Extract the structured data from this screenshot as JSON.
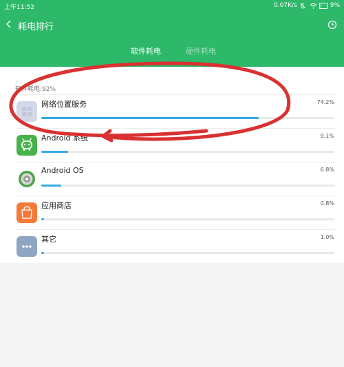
{
  "status_bar": {
    "time": "上午11:52",
    "speed": "0.07K/s",
    "battery": "9%"
  },
  "header": {
    "title": "耗电排行",
    "back_icon": "chevron-left-icon",
    "clock_icon": "clock-icon"
  },
  "tabs": [
    {
      "label": "软件耗电",
      "active": true
    },
    {
      "label": "硬件耗电",
      "active": false
    }
  ],
  "summary": "软件耗电:92%",
  "apps": [
    {
      "name": "网络位置服务",
      "percent": "74.2%",
      "level": 0.742,
      "icon": "location-service-icon",
      "icon_color": "#d4d7e8"
    },
    {
      "name": "Android 系统",
      "percent": "9.1%",
      "level": 0.091,
      "icon": "android-icon",
      "icon_color": "#48b24a"
    },
    {
      "name": "Android OS",
      "percent": "6.8%",
      "level": 0.068,
      "icon": "android-os-icon",
      "icon_color": "#4aa44a"
    },
    {
      "name": "应用商店",
      "percent": "0.8%",
      "level": 0.008,
      "icon": "app-store-icon",
      "icon_color": "#f47a3a"
    },
    {
      "name": "其它",
      "percent": "1.0%",
      "level": 0.01,
      "icon": "more-icon",
      "icon_color": "#8ea6c4"
    }
  ],
  "colors": {
    "header_green": "#2db86a",
    "bar_blue": "#35a9e2",
    "annotation_red": "#d93131"
  }
}
